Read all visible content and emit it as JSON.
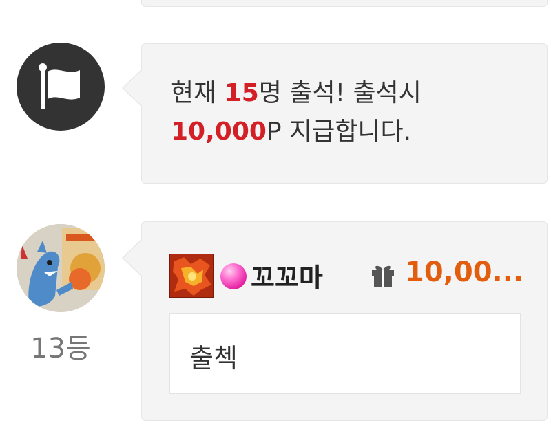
{
  "notice": {
    "icon": "flag-icon",
    "line1_prefix": "현재 ",
    "count": "15",
    "line1_suffix": "명 출석! 출석시",
    "points": "10,000",
    "line2_suffix": "P 지급합니다."
  },
  "entry": {
    "avatar": "user-avatar",
    "rank": "13등",
    "badge_icon": "level-badge-icon",
    "gem_icon": "pink-gem-icon",
    "username": "꼬꼬마",
    "gift_icon": "gift-icon",
    "points": "10,00...",
    "message": "출첵"
  },
  "colors": {
    "highlight_red": "#d32027",
    "points_orange": "#e25d0e",
    "bubble_bg": "#f4f4f4",
    "notice_avatar_bg": "#333333"
  }
}
